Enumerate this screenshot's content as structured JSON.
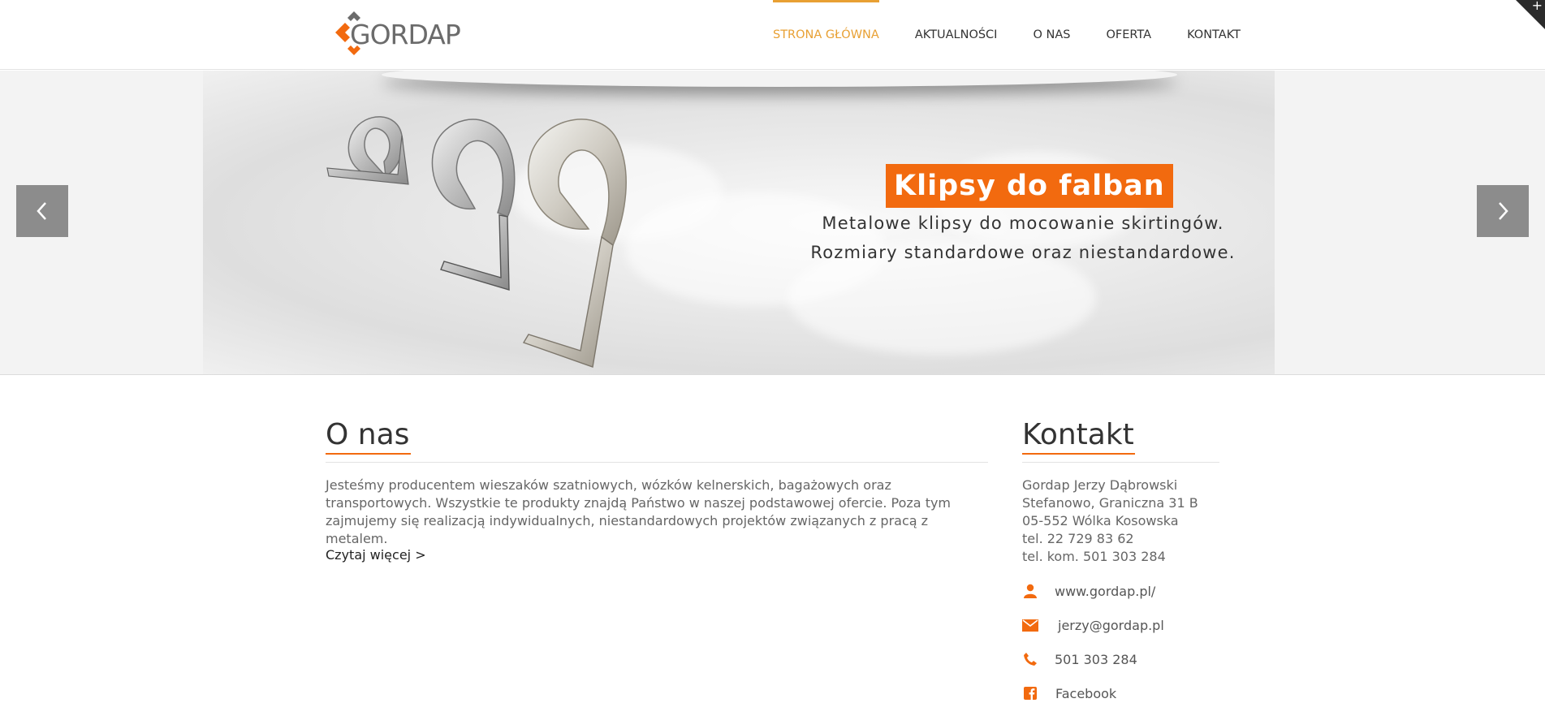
{
  "logo": {
    "text": "GORDAP"
  },
  "nav": {
    "items": [
      {
        "label": "STRONA GŁÓWNA"
      },
      {
        "label": "AKTUALNOŚCI"
      },
      {
        "label": "O NAS"
      },
      {
        "label": "OFERTA"
      },
      {
        "label": "KONTAKT"
      }
    ],
    "active_index": 0
  },
  "colors": {
    "accent": "#f26a0f",
    "nav_active": "#e8a033"
  },
  "slider": {
    "title": "Klipsy do falban",
    "line1": "Metalowe klipsy do mocowanie skirtingów.",
    "line2": "Rozmiary standardowe oraz niestandardowe."
  },
  "about": {
    "title": "O nas",
    "text": "Jesteśmy producentem wieszaków szatniowych, wózków kelnerskich, bagażowych oraz transportowych. Wszystkie te produkty znajdą Państwo w naszej podstawowej ofercie. Poza tym zajmujemy się realizacją indywidualnych, niestandardowych projektów związanych z pracą z metalem.",
    "read_more": "Czytaj więcej >"
  },
  "contact": {
    "title": "Kontakt",
    "lines": [
      "Gordap Jerzy Dąbrowski",
      "Stefanowo, Graniczna 31 B",
      "05-552 Wólka Kosowska",
      "tel. 22 729 83 62",
      "tel. kom. 501 303 284"
    ],
    "website": "www.gordap.pl/",
    "email": "jerzy@gordap.pl",
    "phone": "501 303 284",
    "facebook": "Facebook"
  }
}
